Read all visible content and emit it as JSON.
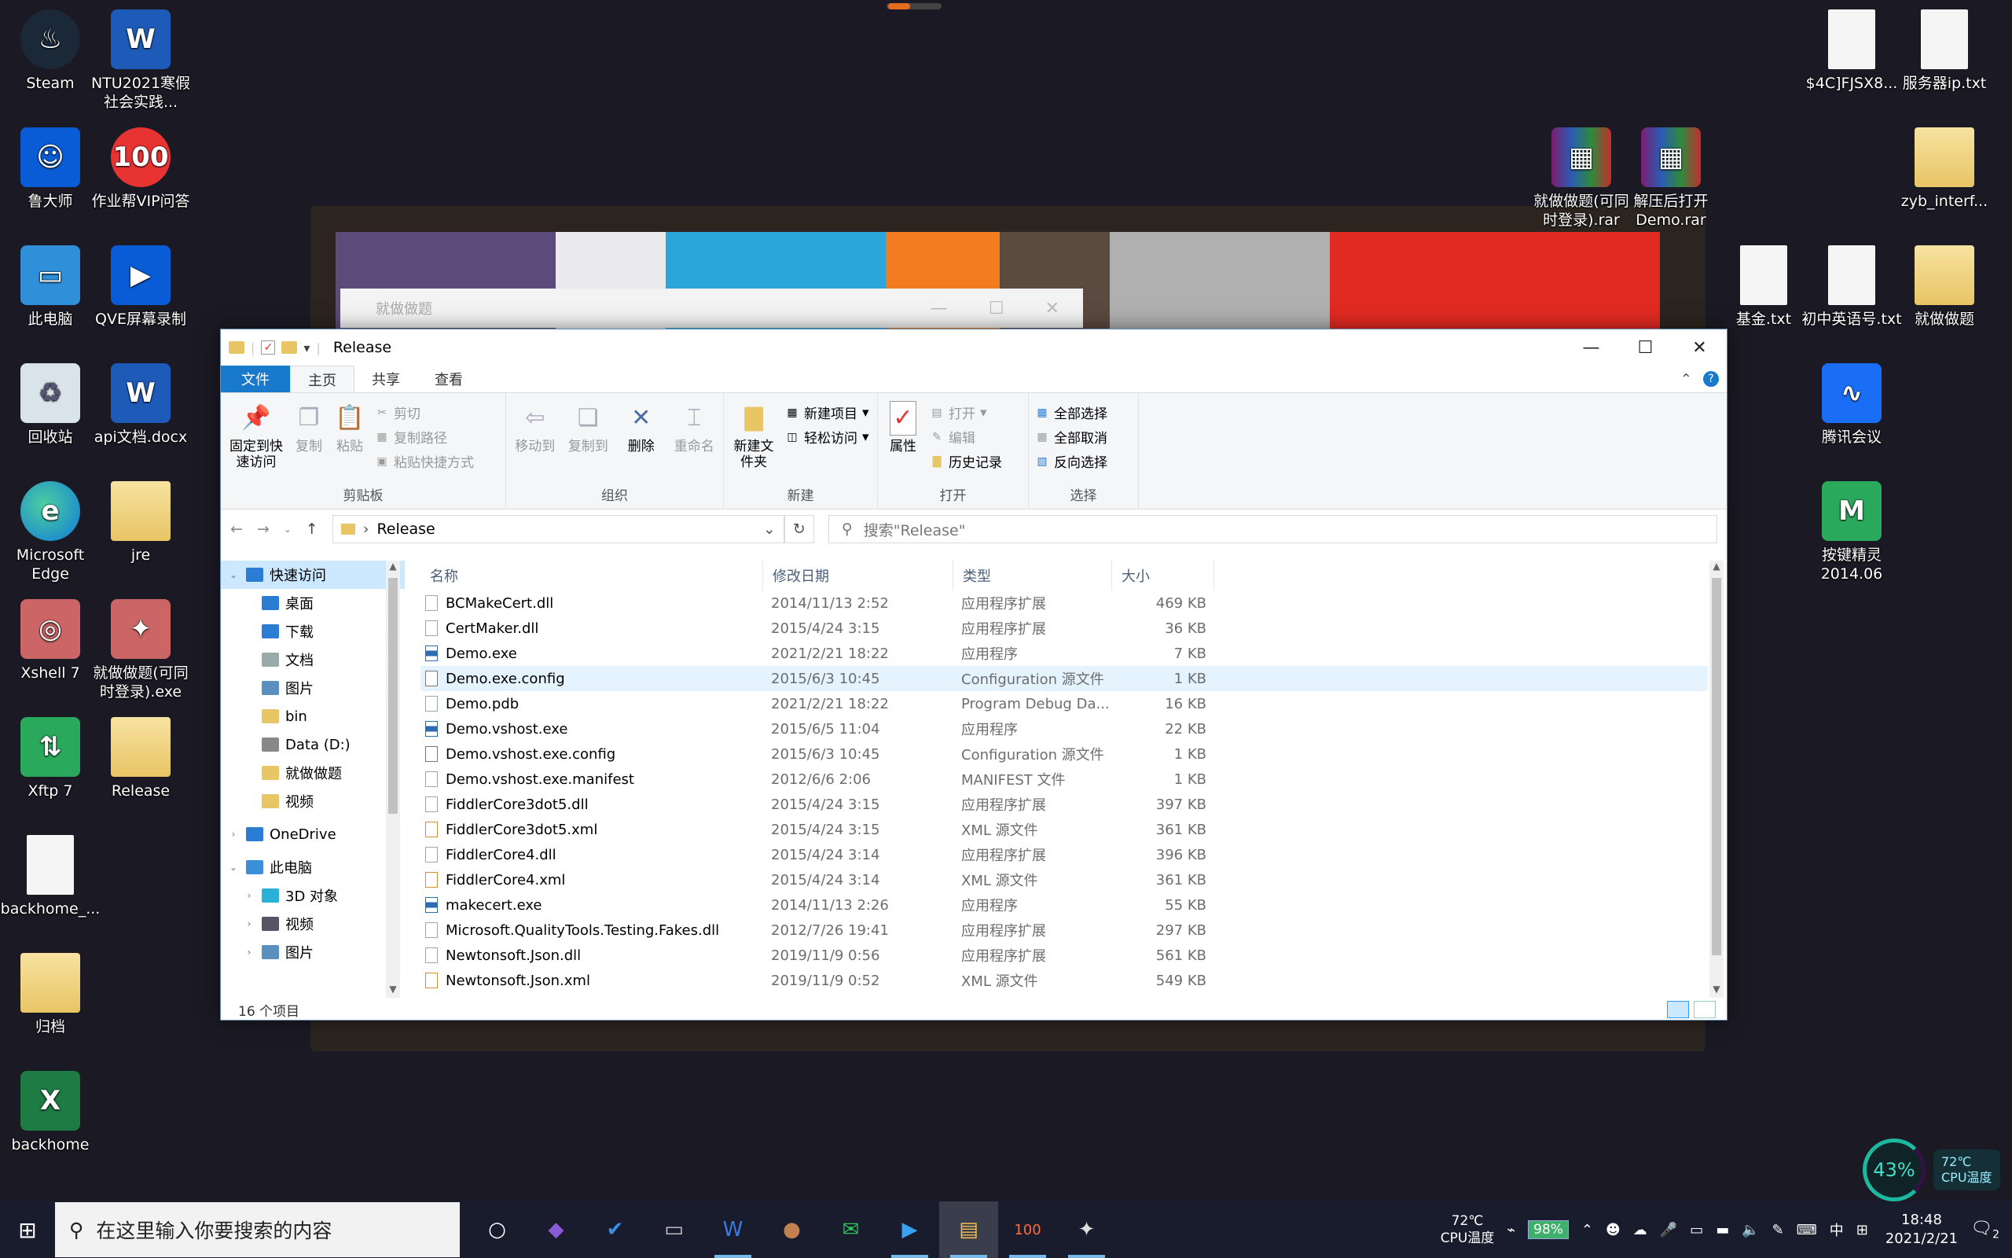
{
  "desktop": {
    "icons_left": [
      {
        "label": "Steam",
        "icon": "steam-icon",
        "glyph": "♨",
        "kind": "steam"
      },
      {
        "label": "NTU2021寒假社会实践...",
        "icon": "word-doc-icon",
        "glyph": "W",
        "kind": "word"
      },
      {
        "label": "鲁大师",
        "icon": "ludashi-icon",
        "glyph": "☺",
        "kind": "blue"
      },
      {
        "label": "作业帮VIP问答",
        "icon": "zuoyebang-icon",
        "glyph": "100",
        "kind": "red"
      },
      {
        "label": "此电脑",
        "icon": "this-pc-icon",
        "glyph": "▭",
        "kind": "pc"
      },
      {
        "label": "QVE屏幕录制",
        "icon": "qve-recorder-icon",
        "glyph": "▶",
        "kind": "blue"
      },
      {
        "label": "回收站",
        "icon": "recycle-bin-icon",
        "glyph": "♻",
        "kind": "bin"
      },
      {
        "label": "api文档.docx",
        "icon": "word-doc-icon",
        "glyph": "W",
        "kind": "word"
      },
      {
        "label": "Microsoft Edge",
        "icon": "edge-icon",
        "glyph": "e",
        "kind": "edge"
      },
      {
        "label": "jre",
        "icon": "folder-icon",
        "glyph": "",
        "kind": "folder"
      },
      {
        "label": "Xshell 7",
        "icon": "xshell-icon",
        "glyph": "◎",
        "kind": "app"
      },
      {
        "label": "就做做题(可同时登录).exe",
        "icon": "exe-icon",
        "glyph": "✦",
        "kind": "app"
      },
      {
        "label": "Xftp 7",
        "icon": "xftp-icon",
        "glyph": "⇅",
        "kind": "green"
      },
      {
        "label": "Release",
        "icon": "folder-icon",
        "glyph": "",
        "kind": "folder"
      },
      {
        "label": "backhome_...",
        "icon": "file-icon",
        "glyph": "",
        "kind": "file"
      },
      {
        "label": "归档",
        "icon": "folder-icon",
        "glyph": "",
        "kind": "folder"
      },
      {
        "label": "backhome",
        "icon": "excel-icon",
        "glyph": "X",
        "kind": "excel"
      }
    ],
    "icons_right": [
      {
        "label": "$4C]FJSX8...",
        "icon": "file-icon",
        "glyph": "",
        "kind": "file"
      },
      {
        "label": "服务器ip.txt",
        "icon": "text-file-icon",
        "glyph": "",
        "kind": "file"
      },
      {
        "label": "就做做题(可同时登录).rar",
        "icon": "rar-icon",
        "glyph": "▦",
        "kind": "rar"
      },
      {
        "label": "解压后打开Demo.rar",
        "icon": "rar-icon",
        "glyph": "▦",
        "kind": "rar"
      },
      {
        "label": "zyb_interf...",
        "icon": "folder-icon",
        "glyph": "",
        "kind": "folder"
      },
      {
        "label": "基金.txt",
        "icon": "text-file-icon",
        "glyph": "",
        "kind": "file"
      },
      {
        "label": "初中英语号.txt",
        "icon": "text-file-icon",
        "glyph": "",
        "kind": "file"
      },
      {
        "label": "就做做题",
        "icon": "folder-icon",
        "glyph": "",
        "kind": "folder"
      },
      {
        "label": "腾讯会议",
        "icon": "tencent-meeting-icon",
        "glyph": "∿",
        "kind": "tencent"
      },
      {
        "label": "按键精灵2014.06",
        "icon": "anjian-icon",
        "glyph": "M",
        "kind": "green"
      }
    ]
  },
  "ghost_window": {
    "title": "就做做题",
    "controls": [
      "—",
      "☐",
      "✕"
    ]
  },
  "explorer": {
    "title": "Release",
    "window_controls": {
      "minimize": "—",
      "maximize": "☐",
      "close": "✕"
    },
    "tabs": [
      "文件",
      "主页",
      "共享",
      "查看"
    ],
    "help": "?",
    "ribbon": {
      "clipboard": {
        "label": "剪贴板",
        "pin": "固定到快速访问",
        "copy": "复制",
        "paste": "粘贴",
        "cut": "剪切",
        "copy_path": "复制路径",
        "paste_shortcut": "粘贴快捷方式"
      },
      "organize": {
        "label": "组织",
        "move_to": "移动到",
        "copy_to": "复制到",
        "delete": "删除",
        "rename": "重命名"
      },
      "new": {
        "label": "新建",
        "new_folder": "新建文件夹",
        "new_item": "新建项目",
        "easy_access": "轻松访问"
      },
      "open": {
        "label": "打开",
        "properties": "属性",
        "open": "打开",
        "edit": "编辑",
        "history": "历史记录"
      },
      "select": {
        "label": "选择",
        "select_all": "全部选择",
        "select_none": "全部取消",
        "invert": "反向选择"
      }
    },
    "address": {
      "path": "Release",
      "search_placeholder": "搜索\"Release\""
    },
    "nav": [
      {
        "label": "快速访问",
        "level": 0,
        "twisty": "⌄",
        "color": "#2b7cd3",
        "selected": true,
        "pin": ""
      },
      {
        "label": "桌面",
        "level": 1,
        "twisty": "",
        "color": "#2b7cd3",
        "selected": false,
        "pin": "📌"
      },
      {
        "label": "下载",
        "level": 1,
        "twisty": "",
        "color": "#2b7cd3",
        "selected": false,
        "pin": "📌"
      },
      {
        "label": "文档",
        "level": 1,
        "twisty": "",
        "color": "#9aa",
        "selected": false,
        "pin": "📌"
      },
      {
        "label": "图片",
        "level": 1,
        "twisty": "",
        "color": "#5a8fc0",
        "selected": false,
        "pin": "📌"
      },
      {
        "label": "bin",
        "level": 1,
        "twisty": "",
        "color": "#e8c565",
        "selected": false,
        "pin": ""
      },
      {
        "label": "Data (D:)",
        "level": 1,
        "twisty": "",
        "color": "#888",
        "selected": false,
        "pin": ""
      },
      {
        "label": "就做做题",
        "level": 1,
        "twisty": "",
        "color": "#e8c565",
        "selected": false,
        "pin": ""
      },
      {
        "label": "视频",
        "level": 1,
        "twisty": "",
        "color": "#e8c565",
        "selected": false,
        "pin": ""
      },
      {
        "label": "OneDrive",
        "level": 0,
        "twisty": "›",
        "color": "#2b7cd3",
        "selected": false,
        "pin": ""
      },
      {
        "label": "此电脑",
        "level": 0,
        "twisty": "⌄",
        "color": "#3b8fd8",
        "selected": false,
        "pin": ""
      },
      {
        "label": "3D 对象",
        "level": 1,
        "twisty": "›",
        "color": "#2bb0d8",
        "selected": false,
        "pin": ""
      },
      {
        "label": "视频",
        "level": 1,
        "twisty": "›",
        "color": "#556",
        "selected": false,
        "pin": ""
      },
      {
        "label": "图片",
        "level": 1,
        "twisty": "›",
        "color": "#5a8fc0",
        "selected": false,
        "pin": ""
      }
    ],
    "columns": {
      "name": "名称",
      "date": "修改日期",
      "type": "类型",
      "size": "大小"
    },
    "files": [
      {
        "name": "BCMakeCert.dll",
        "date": "2014/11/13 2:52",
        "type": "应用程序扩展",
        "size": "469 KB",
        "kind": "dll"
      },
      {
        "name": "CertMaker.dll",
        "date": "2015/4/24 3:15",
        "type": "应用程序扩展",
        "size": "36 KB",
        "kind": "dll"
      },
      {
        "name": "Demo.exe",
        "date": "2021/2/21 18:22",
        "type": "应用程序",
        "size": "7 KB",
        "kind": "exe"
      },
      {
        "name": "Demo.exe.config",
        "date": "2015/6/3 10:45",
        "type": "Configuration 源文件",
        "size": "1 KB",
        "kind": "cfg"
      },
      {
        "name": "Demo.pdb",
        "date": "2021/2/21 18:22",
        "type": "Program Debug Da...",
        "size": "16 KB",
        "kind": "file"
      },
      {
        "name": "Demo.vshost.exe",
        "date": "2015/6/5 11:04",
        "type": "应用程序",
        "size": "22 KB",
        "kind": "exe"
      },
      {
        "name": "Demo.vshost.exe.config",
        "date": "2015/6/3 10:45",
        "type": "Configuration 源文件",
        "size": "1 KB",
        "kind": "cfg"
      },
      {
        "name": "Demo.vshost.exe.manifest",
        "date": "2012/6/6 2:06",
        "type": "MANIFEST 文件",
        "size": "1 KB",
        "kind": "file"
      },
      {
        "name": "FiddlerCore3dot5.dll",
        "date": "2015/4/24 3:15",
        "type": "应用程序扩展",
        "size": "397 KB",
        "kind": "dll"
      },
      {
        "name": "FiddlerCore3dot5.xml",
        "date": "2015/4/24 3:15",
        "type": "XML 源文件",
        "size": "361 KB",
        "kind": "xml"
      },
      {
        "name": "FiddlerCore4.dll",
        "date": "2015/4/24 3:14",
        "type": "应用程序扩展",
        "size": "396 KB",
        "kind": "dll"
      },
      {
        "name": "FiddlerCore4.xml",
        "date": "2015/4/24 3:14",
        "type": "XML 源文件",
        "size": "361 KB",
        "kind": "xml"
      },
      {
        "name": "makecert.exe",
        "date": "2014/11/13 2:26",
        "type": "应用程序",
        "size": "55 KB",
        "kind": "exe"
      },
      {
        "name": "Microsoft.QualityTools.Testing.Fakes.dll",
        "date": "2012/7/26 19:41",
        "type": "应用程序扩展",
        "size": "297 KB",
        "kind": "dll"
      },
      {
        "name": "Newtonsoft.Json.dll",
        "date": "2019/11/9 0:56",
        "type": "应用程序扩展",
        "size": "561 KB",
        "kind": "dll"
      },
      {
        "name": "Newtonsoft.Json.xml",
        "date": "2019/11/9 0:52",
        "type": "XML 源文件",
        "size": "549 KB",
        "kind": "xml"
      }
    ],
    "hover_row": 3,
    "status": "16 个项目"
  },
  "widget": {
    "cpu_percent": "43%",
    "cpu_temp": "72℃",
    "cpu_temp_label": "CPU温度"
  },
  "taskbar": {
    "search_placeholder": "在这里输入你要搜索的内容",
    "apps": [
      {
        "name": "cortana-icon",
        "glyph": "○",
        "color": "#ffffff",
        "state": ""
      },
      {
        "name": "visual-studio-icon",
        "glyph": "◆",
        "color": "#8a5ad8",
        "state": ""
      },
      {
        "name": "todo-icon",
        "glyph": "✔",
        "color": "#3a8ee6",
        "state": ""
      },
      {
        "name": "terminal-icon",
        "glyph": "▭",
        "color": "#cccccc",
        "state": ""
      },
      {
        "name": "word-icon",
        "glyph": "W",
        "color": "#3a7be0",
        "state": "running"
      },
      {
        "name": "user-app-icon",
        "glyph": "●",
        "color": "#c08050",
        "state": ""
      },
      {
        "name": "wechat-icon",
        "glyph": "✉",
        "color": "#2fc25b",
        "state": ""
      },
      {
        "name": "qve-icon",
        "glyph": "▶",
        "color": "#3aa0f0",
        "state": "running"
      },
      {
        "name": "file-explorer-icon",
        "glyph": "▤",
        "color": "#f2c14e",
        "state": "active running"
      },
      {
        "name": "zuoyebang-icon",
        "glyph": "100",
        "color": "#ff6b3d",
        "state": "running"
      },
      {
        "name": "game-icon",
        "glyph": "✦",
        "color": "#dddddd",
        "state": "running"
      }
    ],
    "tray": {
      "temp": "72℃",
      "temp_label": "CPU温度",
      "battery": "98%",
      "ime": "中",
      "time": "18:48",
      "date": "2021/2/21",
      "notifications": "2"
    }
  },
  "colors": {
    "accent": "#1979ca",
    "selection": "#cce8ff"
  }
}
